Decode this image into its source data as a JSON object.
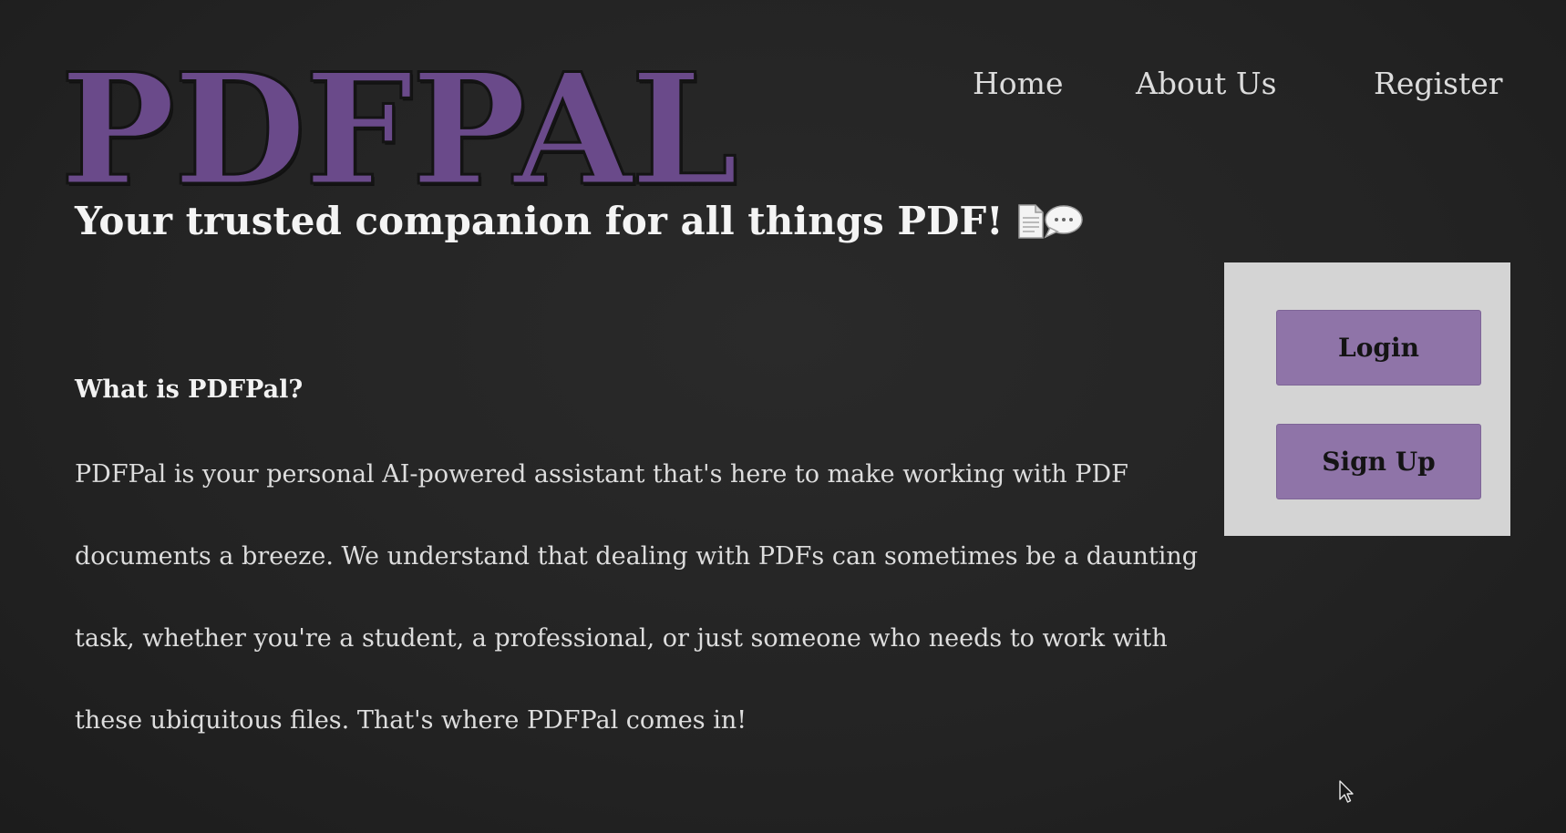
{
  "brand": {
    "logo_text": "PDFPAL",
    "logo_color": "#6a4a8a"
  },
  "nav": {
    "items": [
      {
        "label": "Home"
      },
      {
        "label": "About Us"
      },
      {
        "label": "Register"
      }
    ]
  },
  "hero": {
    "tagline": "Your trusted companion for all things PDF!",
    "tagline_icons": [
      "document-icon",
      "speech-bubble-icon"
    ]
  },
  "about": {
    "heading": "What is PDFPal?",
    "lines": [
      "PDFPal is your personal AI-powered assistant that's here to make working with PDF",
      "documents a breeze. We understand that dealing with PDFs can sometimes be a daunting",
      "task, whether you're a student, a professional, or just someone who needs to work with",
      "these ubiquitous files. That's where PDFPal comes in!"
    ]
  },
  "auth": {
    "login_label": "Login",
    "signup_label": "Sign Up",
    "panel_color": "#d4d4d4",
    "button_color": "#8f74a8"
  }
}
